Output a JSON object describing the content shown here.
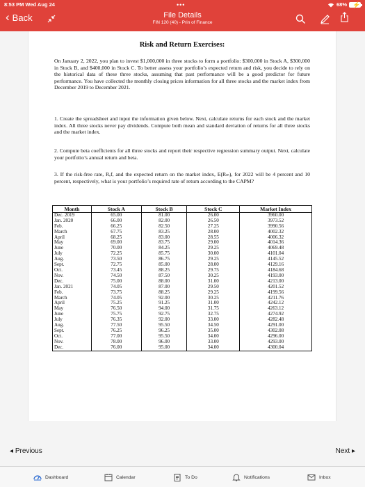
{
  "status": {
    "time": "8:53 PM  Wed Aug 24",
    "battery": "68%"
  },
  "header": {
    "back_label": "Back",
    "title": "File Details",
    "subtitle": "FIN 120 (40) - Prin of Finance"
  },
  "document": {
    "title": "Risk and Return Exercises:",
    "paragraphs": [
      "On January 2, 2022, you plan to invest $1,000,000 in three stocks to form a portfolio: $300,000 in Stock A, $300,000 in Stock B, and $400,000 in Stock C. To better assess your portfolio’s expected return and risk, you decide to rely on the historical data of these three stocks, assuming that past performance will be a good predictor for future performance. You have collected the monthly closing prices information for all three stocks and the market index from December 2019 to December 2021.",
      "1.  Create the spreadsheet and input the information given below. Next, calculate returns for each stock and the market index. All three stocks never pay dividends. Compute both mean and standard deviation of returns for all three stocks and the market index.",
      "2.  Compute beta coefficients for all three stocks and report their respective regression summary output. Next, calculate your portfolio’s annual return and beta.",
      "3.  If the risk-free rate, Rₑf, and the expected return on the market index, E(Rₘ), for 2022 will be 4 percent and 10 percent, respectively, what is your portfolio’s required rate of return according to the CAPM?"
    ],
    "table": {
      "headers": [
        "Month",
        "Stock A",
        "Stock B",
        "Stock C",
        "Market Index"
      ],
      "rows": [
        [
          "Dec. 2019",
          "65.00",
          "81.00",
          "26.00",
          "3960.00"
        ],
        [
          "Jan. 2020",
          "66.00",
          "82.00",
          "26.50",
          "3973.52"
        ],
        [
          "Feb.",
          "66.25",
          "82.50",
          "27.25",
          "3990.56"
        ],
        [
          "March",
          "67.75",
          "83.25",
          "28.00",
          "4002.32"
        ],
        [
          "April",
          "68.25",
          "83.00",
          "28.55",
          "4006.32"
        ],
        [
          "May",
          "69.00",
          "83.75",
          "29.00",
          "4014.36"
        ],
        [
          "June",
          "70.00",
          "84.25",
          "29.25",
          "4069.48"
        ],
        [
          "July",
          "72.25",
          "85.75",
          "30.00",
          "4101.04"
        ],
        [
          "Aug.",
          "73.50",
          "86.75",
          "29.25",
          "4145.52"
        ],
        [
          "Sept.",
          "72.75",
          "85.00",
          "28.00",
          "4129.16"
        ],
        [
          "Oct.",
          "73.45",
          "88.25",
          "29.75",
          "4184.68"
        ],
        [
          "Nov.",
          "74.50",
          "87.50",
          "30.25",
          "4193.00"
        ],
        [
          "Dec.",
          "75.00",
          "88.00",
          "31.00",
          "4213.00"
        ],
        [
          "Jan. 2021",
          "74.05",
          "87.00",
          "29.50",
          "4201.52"
        ],
        [
          "Feb.",
          "73.75",
          "88.25",
          "29.25",
          "4199.56"
        ],
        [
          "March",
          "74.05",
          "92.00",
          "30.25",
          "4211.76"
        ],
        [
          "April",
          "75.25",
          "91.25",
          "31.00",
          "4242.12"
        ],
        [
          "May",
          "76.50",
          "94.00",
          "31.75",
          "4263.12"
        ],
        [
          "June",
          "75.75",
          "92.75",
          "32.75",
          "4274.92"
        ],
        [
          "July",
          "76.35",
          "92.00",
          "33.00",
          "4282.48"
        ],
        [
          "Aug.",
          "77.50",
          "95.50",
          "34.50",
          "4291.00"
        ],
        [
          "Sept.",
          "76.25",
          "96.25",
          "35.00",
          "4302.08"
        ],
        [
          "Oct.",
          "77.00",
          "95.50",
          "34.00",
          "4296.00"
        ],
        [
          "Nov.",
          "78.00",
          "96.00",
          "33.00",
          "4293.00"
        ],
        [
          "Dec.",
          "76.00",
          "95.00",
          "34.00",
          "4300.04"
        ]
      ]
    }
  },
  "pager": {
    "previous": "Previous",
    "next": "Next"
  },
  "tabbar": [
    {
      "label": "Dashboard",
      "icon": "dashboard-icon"
    },
    {
      "label": "Calendar",
      "icon": "calendar-icon"
    },
    {
      "label": "To Do",
      "icon": "todo-icon"
    },
    {
      "label": "Notifications",
      "icon": "bell-icon"
    },
    {
      "label": "Inbox",
      "icon": "inbox-icon"
    }
  ],
  "colors": {
    "header_bg": "#e0423a",
    "battery_bolt": "#39b54a"
  }
}
